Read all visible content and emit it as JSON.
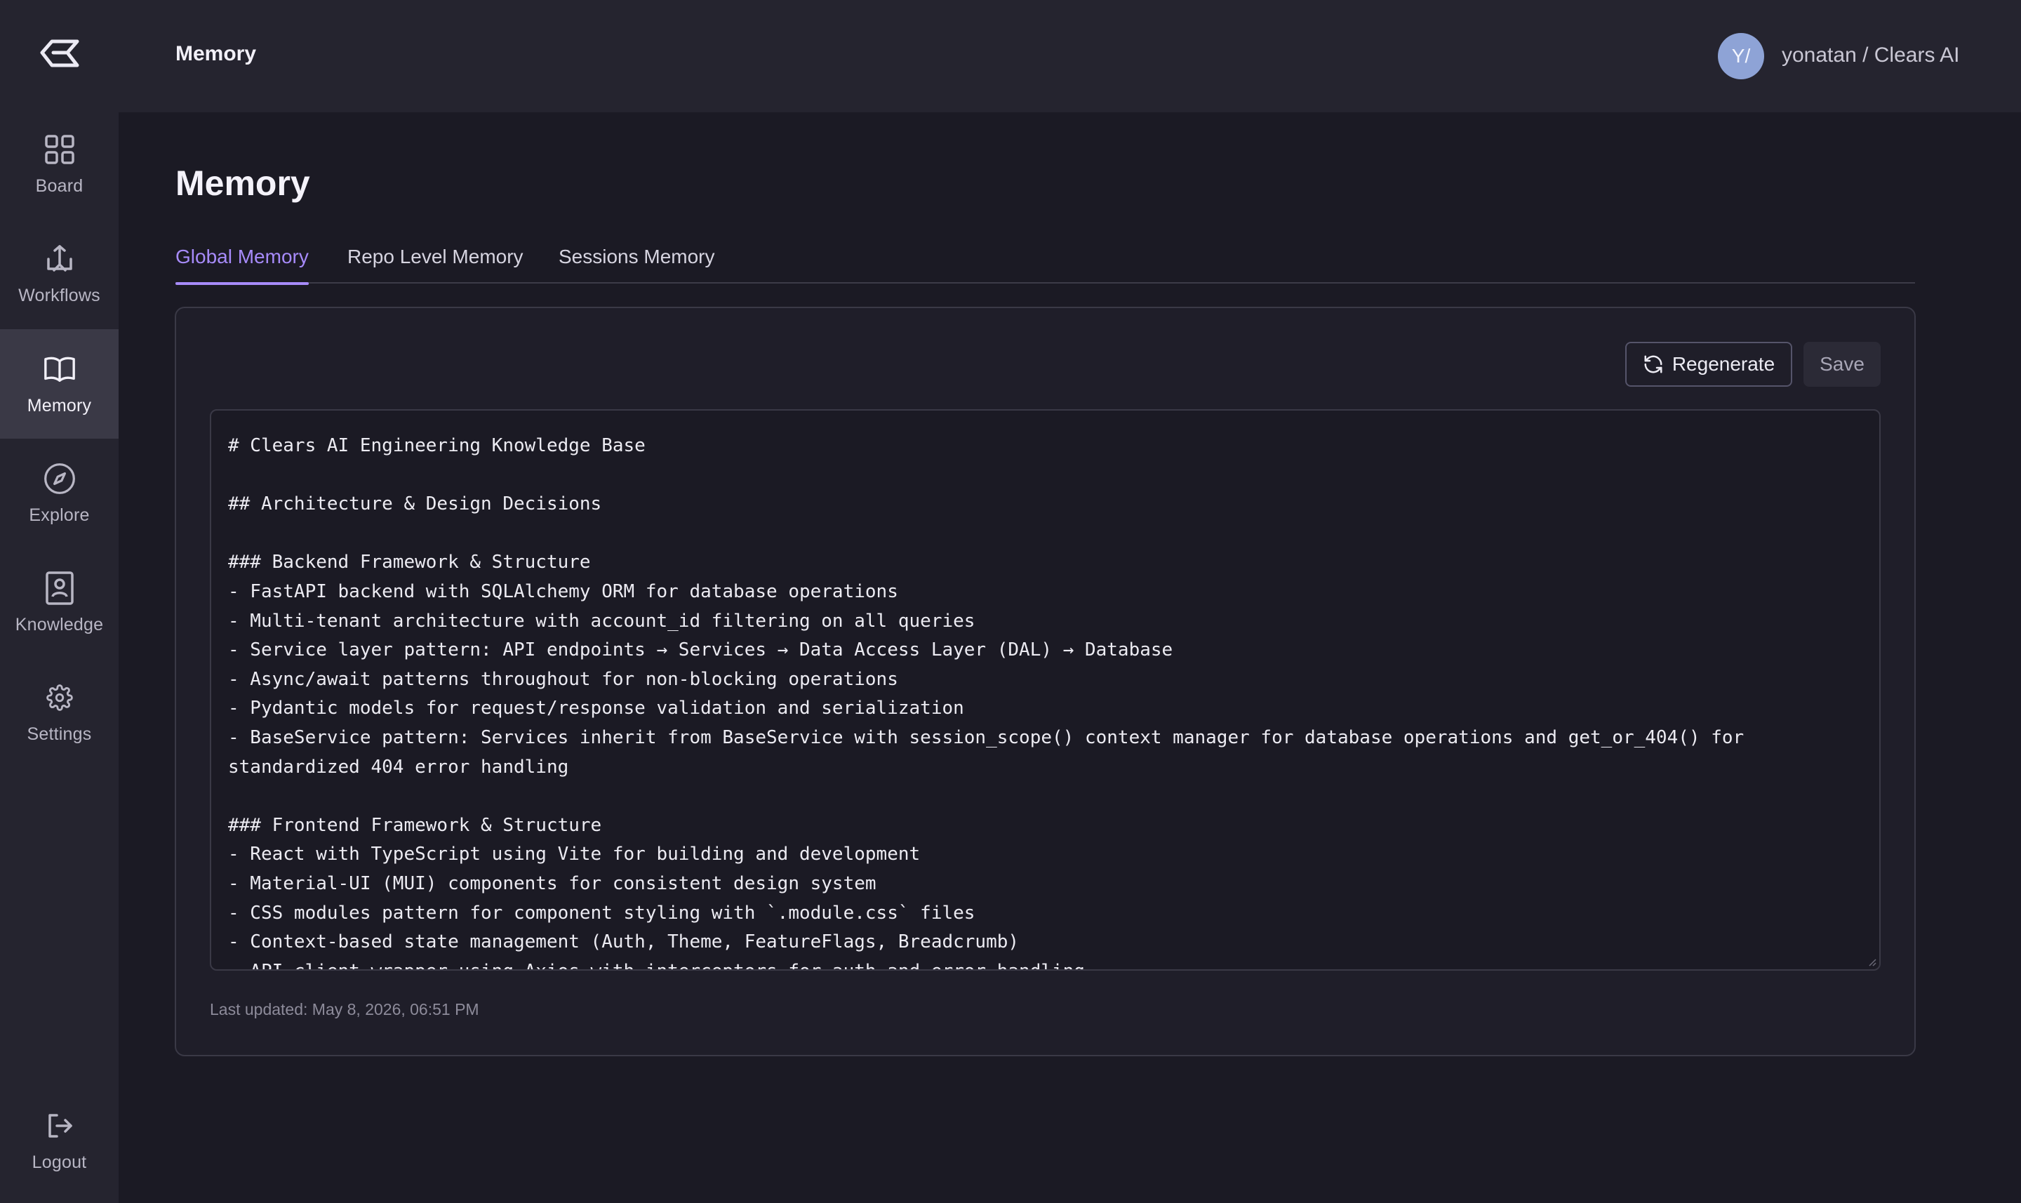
{
  "sidebar": {
    "logo_icon": "app-logo-icon",
    "items": [
      {
        "label": "Board",
        "icon": "grid-icon"
      },
      {
        "label": "Workflows",
        "icon": "workflow-icon"
      },
      {
        "label": "Memory",
        "icon": "book-icon",
        "active": true
      },
      {
        "label": "Explore",
        "icon": "compass-icon"
      },
      {
        "label": "Knowledge",
        "icon": "contact-book-icon"
      },
      {
        "label": "Settings",
        "icon": "gear-icon"
      }
    ],
    "logout": {
      "label": "Logout",
      "icon": "logout-icon"
    }
  },
  "header": {
    "title": "Memory",
    "avatar_initials": "Y/",
    "user": "yonatan / Clears AI"
  },
  "main": {
    "title": "Memory",
    "tabs": [
      {
        "label": "Global Memory",
        "active": true
      },
      {
        "label": "Repo Level Memory",
        "active": false
      },
      {
        "label": "Sessions Memory",
        "active": false
      }
    ],
    "regenerate_label": "Regenerate",
    "save_label": "Save",
    "editor_content": "# Clears AI Engineering Knowledge Base\n\n## Architecture & Design Decisions\n\n### Backend Framework & Structure\n- FastAPI backend with SQLAlchemy ORM for database operations\n- Multi-tenant architecture with account_id filtering on all queries\n- Service layer pattern: API endpoints → Services → Data Access Layer (DAL) → Database\n- Async/await patterns throughout for non-blocking operations\n- Pydantic models for request/response validation and serialization\n- BaseService pattern: Services inherit from BaseService with session_scope() context manager for database operations and get_or_404() for\nstandardized 404 error handling\n\n### Frontend Framework & Structure\n- React with TypeScript using Vite for building and development\n- Material-UI (MUI) components for consistent design system\n- CSS modules pattern for component styling with `.module.css` files\n- Context-based state management (Auth, Theme, FeatureFlags, Breadcrumb)\n- API client wrapper using Axios with interceptors for auth and error handling",
    "last_updated": "Last updated: May 8, 2026, 06:51 PM"
  },
  "colors": {
    "accent": "#a78bfa",
    "sidebar_bg": "#25242f",
    "page_bg": "#1b1a24",
    "avatar_bg": "#8ea3d6"
  }
}
